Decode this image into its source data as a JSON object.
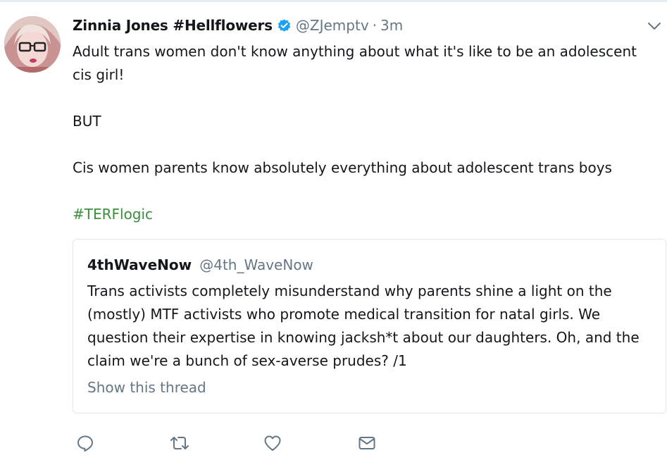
{
  "tweet": {
    "author_name": "Zinnia Jones #Hellflowers",
    "handle": "@ZJemptv",
    "separator": "·",
    "time": "3m",
    "lines": [
      "Adult trans women don't know anything about what it's like to be an adolescent cis girl!",
      "",
      "BUT",
      "",
      "Cis women parents know absolutely everything about adolescent trans boys",
      ""
    ],
    "hashtag": "#TERFlogic"
  },
  "quoted_tweet": {
    "author_name": "4thWaveNow",
    "handle": "@4th_WaveNow",
    "text": "Trans activists completely misunderstand why parents shine a light on the (mostly) MTF activists who promote medical transition for natal girls. We question their expertise in knowing jacksh*t about our daughters. Oh, and the claim we're a bunch of sex-averse prudes? /1",
    "show_thread": "Show this thread"
  },
  "actions": [
    {
      "icon": "reply-icon"
    },
    {
      "icon": "retweet-icon"
    },
    {
      "icon": "like-icon"
    },
    {
      "icon": "direct-message-icon"
    }
  ],
  "colors": {
    "hashtag": "#3a8f3a",
    "verified": "#1da1f2",
    "secondary_text": "#657786",
    "border": "#e1e8ed"
  }
}
